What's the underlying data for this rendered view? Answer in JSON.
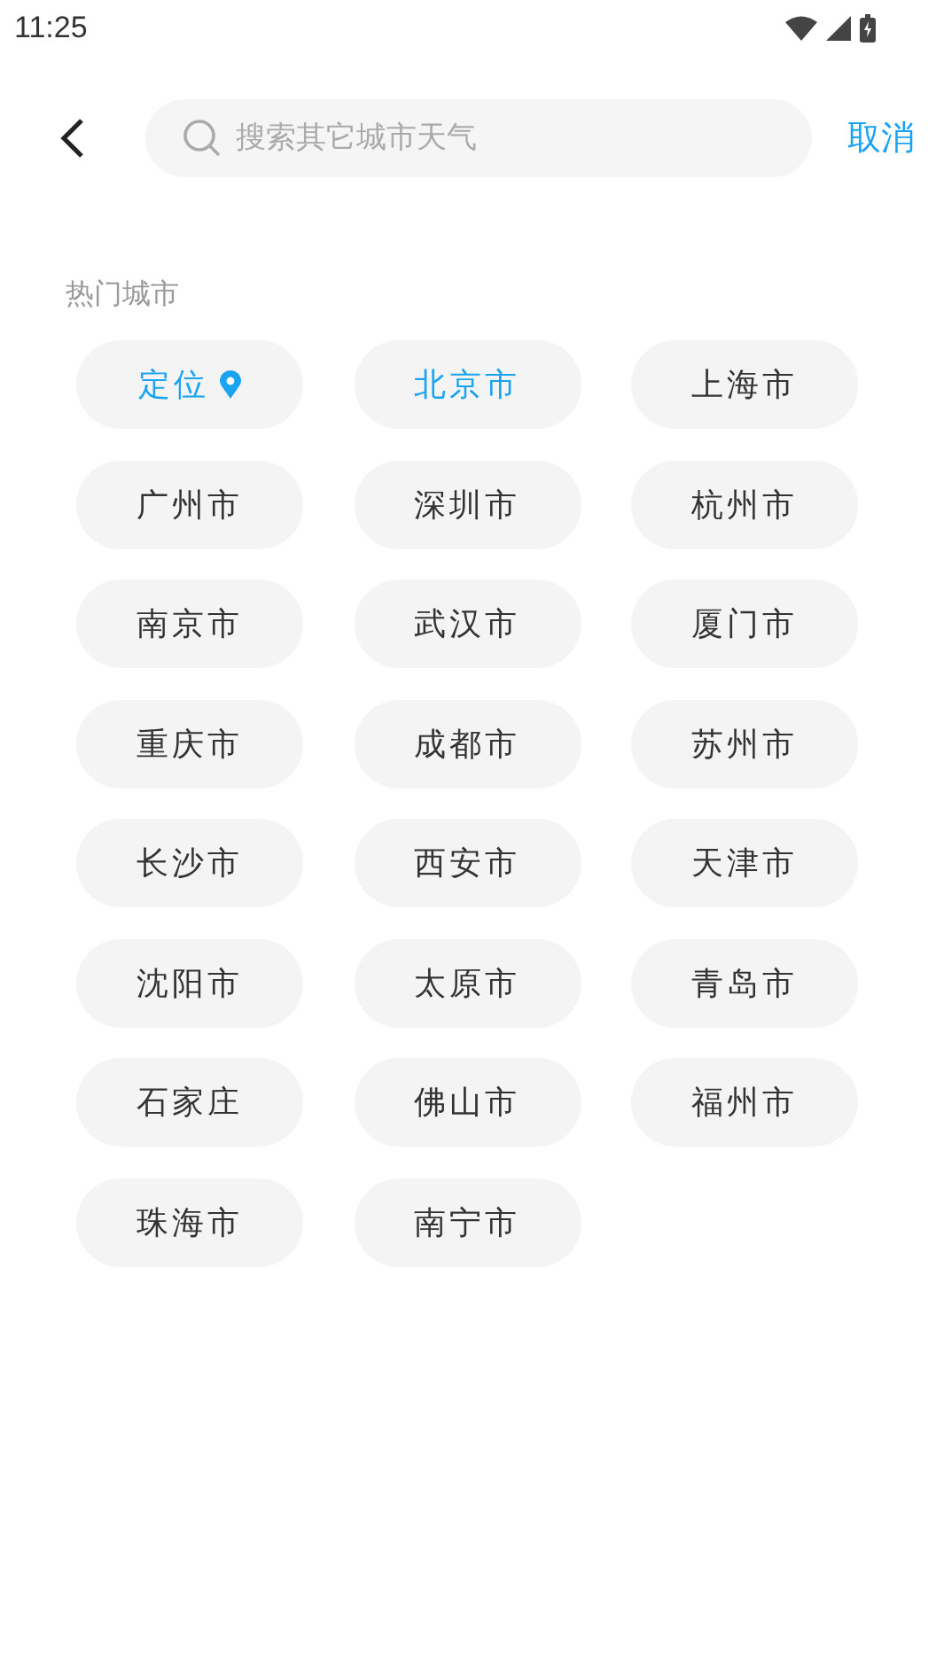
{
  "status_bar": {
    "time": "11:25"
  },
  "search": {
    "placeholder": "搜索其它城市天气",
    "cancel": "取消"
  },
  "section_title": "热门城市",
  "cities": [
    {
      "kind": "locate",
      "name": "定位"
    },
    {
      "kind": "city",
      "name": "北京市",
      "selected": true
    },
    {
      "kind": "city",
      "name": "上海市",
      "selected": false
    },
    {
      "kind": "city",
      "name": "广州市",
      "selected": false
    },
    {
      "kind": "city",
      "name": "深圳市",
      "selected": false
    },
    {
      "kind": "city",
      "name": "杭州市",
      "selected": false
    },
    {
      "kind": "city",
      "name": "南京市",
      "selected": false
    },
    {
      "kind": "city",
      "name": "武汉市",
      "selected": false
    },
    {
      "kind": "city",
      "name": "厦门市",
      "selected": false
    },
    {
      "kind": "city",
      "name": "重庆市",
      "selected": false
    },
    {
      "kind": "city",
      "name": "成都市",
      "selected": false
    },
    {
      "kind": "city",
      "name": "苏州市",
      "selected": false
    },
    {
      "kind": "city",
      "name": "长沙市",
      "selected": false
    },
    {
      "kind": "city",
      "name": "西安市",
      "selected": false
    },
    {
      "kind": "city",
      "name": "天津市",
      "selected": false
    },
    {
      "kind": "city",
      "name": "沈阳市",
      "selected": false
    },
    {
      "kind": "city",
      "name": "太原市",
      "selected": false
    },
    {
      "kind": "city",
      "name": "青岛市",
      "selected": false
    },
    {
      "kind": "city",
      "name": "石家庄",
      "selected": false
    },
    {
      "kind": "city",
      "name": "佛山市",
      "selected": false
    },
    {
      "kind": "city",
      "name": "福州市",
      "selected": false
    },
    {
      "kind": "city",
      "name": "珠海市",
      "selected": false
    },
    {
      "kind": "city",
      "name": "南宁市",
      "selected": false
    }
  ]
}
